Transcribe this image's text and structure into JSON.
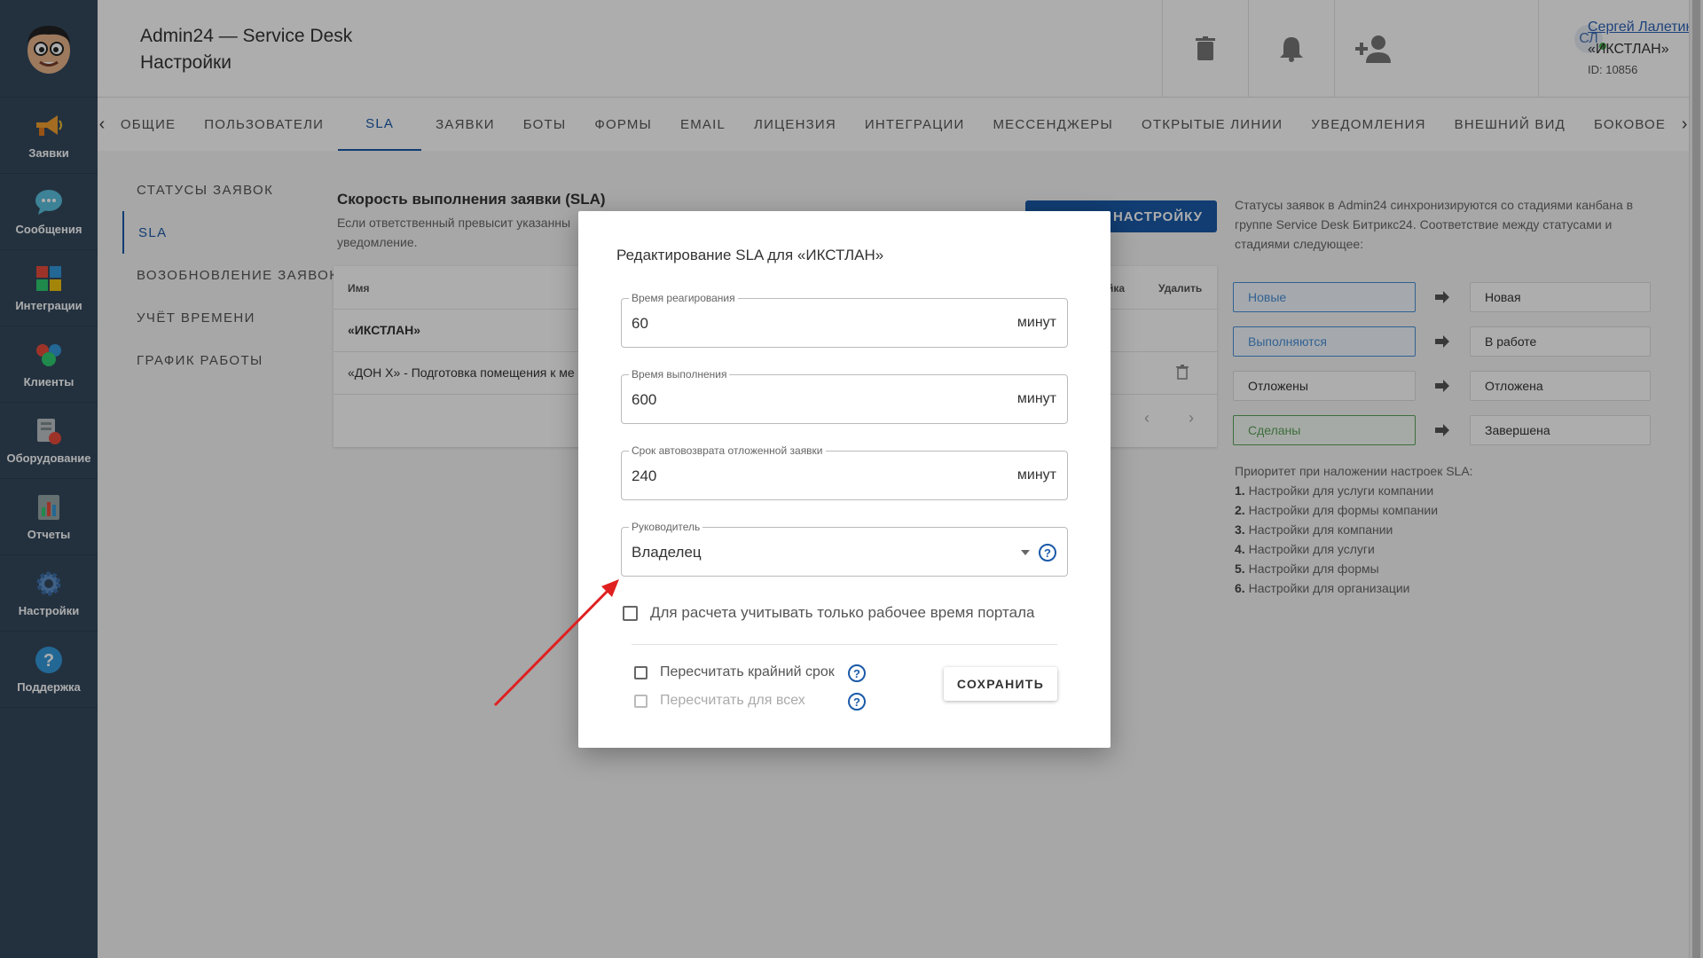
{
  "app": {
    "title": "Admin24 — Service Desk",
    "subtitle": "Настройки"
  },
  "sidebar": {
    "items": [
      {
        "label": "Заявки",
        "icon": "megaphone-icon"
      },
      {
        "label": "Сообщения",
        "icon": "chat-icon"
      },
      {
        "label": "Интеграции",
        "icon": "puzzle-icon"
      },
      {
        "label": "Клиенты",
        "icon": "people-icon"
      },
      {
        "label": "Оборудование",
        "icon": "equipment-icon"
      },
      {
        "label": "Отчеты",
        "icon": "report-icon"
      },
      {
        "label": "Настройки",
        "icon": "gear-icon"
      },
      {
        "label": "Поддержка",
        "icon": "help-icon"
      }
    ]
  },
  "user": {
    "initials": "СЛ",
    "name": "Сергей Лалетин",
    "org": "«ИКСТЛАН»",
    "id": "ID: 10856"
  },
  "tabs": [
    "ОБЩИЕ",
    "ПОЛЬЗОВАТЕЛИ",
    "SLA",
    "ЗАЯВКИ",
    "БОТЫ",
    "ФОРМЫ",
    "EMAIL",
    "ЛИЦЕНЗИЯ",
    "ИНТЕГРАЦИИ",
    "МЕССЕНДЖЕРЫ",
    "ОТКРЫТЫЕ ЛИНИИ",
    "УВЕДОМЛЕНИЯ",
    "ВНЕШНИЙ ВИД",
    "БОКОВОЕ"
  ],
  "subnav": [
    "СТАТУСЫ ЗАЯВОК",
    "SLA",
    "ВОЗОБНОВЛЕНИЕ ЗАЯВОК",
    "УЧЁТ ВРЕМЕНИ",
    "ГРАФИК РАБОТЫ"
  ],
  "content": {
    "title": "Скорость выполнения заявки (SLA)",
    "desc": "Если ответственный превысит указанны уведомление.",
    "add_button": "Ь НАСТРОЙКУ",
    "table": {
      "col_name": "Имя",
      "col_edit": "йка",
      "col_delete": "Удалить",
      "rows": [
        "«ИКСТЛАН»",
        "«ДОН Х» - Подготовка помещения к ме"
      ]
    }
  },
  "info": {
    "text": "Статусы заявок в Admin24 синхронизируются со стадиями канбана в группе Service Desk Битрикс24. Соответствие между статусами и стадиями следующее:",
    "mapping": [
      {
        "from": "Новые",
        "to": "Новая",
        "color": "#4a90d9"
      },
      {
        "from": "Выполняются",
        "to": "В работе",
        "color": "#4a90d9"
      },
      {
        "from": "Отложены",
        "to": "Отложена",
        "color": "#333333"
      },
      {
        "from": "Сделаны",
        "to": "Завершена",
        "color": "#5aa35a"
      }
    ],
    "priority_title": "Приоритет при наложении настроек SLA:",
    "priority": [
      {
        "num": "1.",
        "text": "Настройки для услуги компании"
      },
      {
        "num": "2.",
        "text": "Настройки для формы компании"
      },
      {
        "num": "3.",
        "text": "Настройки для компании"
      },
      {
        "num": "4.",
        "text": "Настройки для услуги"
      },
      {
        "num": "5.",
        "text": "Настройки для формы"
      },
      {
        "num": "6.",
        "text": "Настройки для организации"
      }
    ]
  },
  "modal": {
    "title": "Редактирование SLA для «ИКСТЛАН»",
    "reaction": {
      "label": "Время реагирования",
      "value": "60",
      "unit": "минут"
    },
    "execution": {
      "label": "Время выполнения",
      "value": "600",
      "unit": "минут"
    },
    "autoreturn": {
      "label": "Срок автовозврата отложенной заявки",
      "value": "240",
      "unit": "минут"
    },
    "manager": {
      "label": "Руководитель",
      "value": "Владелец"
    },
    "work_time_checkbox": "Для расчета учитывать только рабочее время портала",
    "recalc_deadline": "Пересчитать крайний срок",
    "recalc_all": "Пересчитать для всех",
    "save": "СОХРАНИТЬ"
  },
  "colors": {
    "sidebar": "#34495e",
    "accent": "#1a5aa8",
    "annotation_arrow": "#e02020"
  }
}
